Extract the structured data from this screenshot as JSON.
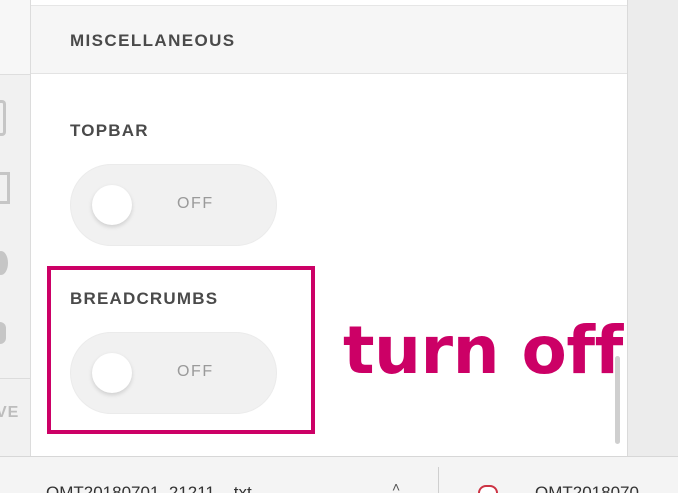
{
  "left_strip": {
    "partial_label": "VE"
  },
  "section": {
    "title": "MISCELLANEOUS"
  },
  "fields": [
    {
      "label": "TOPBAR",
      "state": "OFF"
    },
    {
      "label": "BREADCRUMBS",
      "state": "OFF"
    }
  ],
  "annotation": {
    "text": "turn off",
    "color": "#cc0066"
  },
  "downloads": {
    "items": [
      {
        "filename": "OMT20180701_21211....txt"
      },
      {
        "filename": "OMT2018070"
      }
    ],
    "more_label": "..."
  },
  "colors": {
    "accent": "#cc0066",
    "toggle_bg": "#f1f1f1",
    "header_bg": "#f6f6f6"
  }
}
